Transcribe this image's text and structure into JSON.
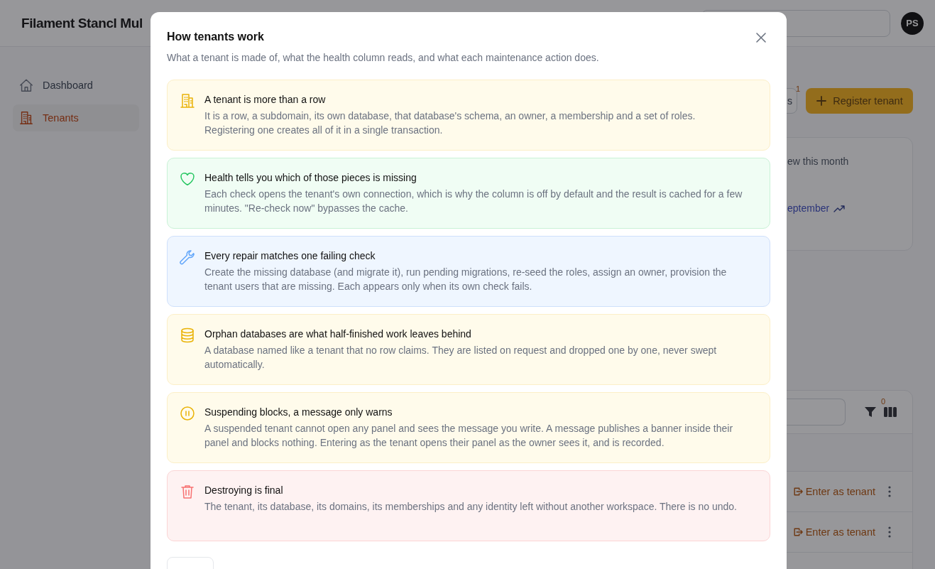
{
  "app": {
    "title": "Filament Stancl Mul",
    "avatar": "PS"
  },
  "sidebar": {
    "items": [
      {
        "label": "Dashboard",
        "selected": false
      },
      {
        "label": "Tenants",
        "selected": true
      }
    ]
  },
  "actions": {
    "partial_button": {
      "label": "s",
      "badge": "1"
    },
    "register_button": "Register tenant"
  },
  "stat": {
    "label": "ew this month",
    "trend": "eptember"
  },
  "table": {
    "filter_badge": "0",
    "rows": [
      {
        "action": "Enter as tenant"
      },
      {
        "action": "Enter as tenant"
      }
    ]
  },
  "modal": {
    "title": "How tenants work",
    "subtitle": "What a tenant is made of, what the health column reads, and what each maintenance action does.",
    "cards": [
      {
        "kind": "building",
        "title": "A tenant is more than a row",
        "text": "It is a row, a subdomain, its own database, that database's schema, an owner, a membership and a set of roles. Registering one creates all of it in a single transaction."
      },
      {
        "kind": "heart",
        "title": "Health tells you which of those pieces is missing",
        "text": "Each check opens the tenant's own connection, which is why the column is off by default and the result is cached for a few minutes. \"Re-check now\" bypasses the cache."
      },
      {
        "kind": "wrench",
        "title": "Every repair matches one failing check",
        "text": "Create the missing database (and migrate it), run pending migrations, re-seed the roles, assign an owner, provision the tenant users that are missing. Each appears only when its own check fails."
      },
      {
        "kind": "database",
        "title": "Orphan databases are what half-finished work leaves behind",
        "text": "A database named like a tenant that no row claims. They are listed on request and dropped one by one, never swept automatically."
      },
      {
        "kind": "pause",
        "title": "Suspending blocks, a message only warns",
        "text": "A suspended tenant cannot open any panel and sees the message you write. A message publishes a banner inside their panel and blocks nothing. Entering as the tenant opens their panel as the owner sees it, and is recorded."
      },
      {
        "kind": "trash",
        "title": "Destroying is final",
        "text": "The tenant, its database, its domains, its memberships and any identity left without another workspace. There is no undo."
      }
    ]
  }
}
